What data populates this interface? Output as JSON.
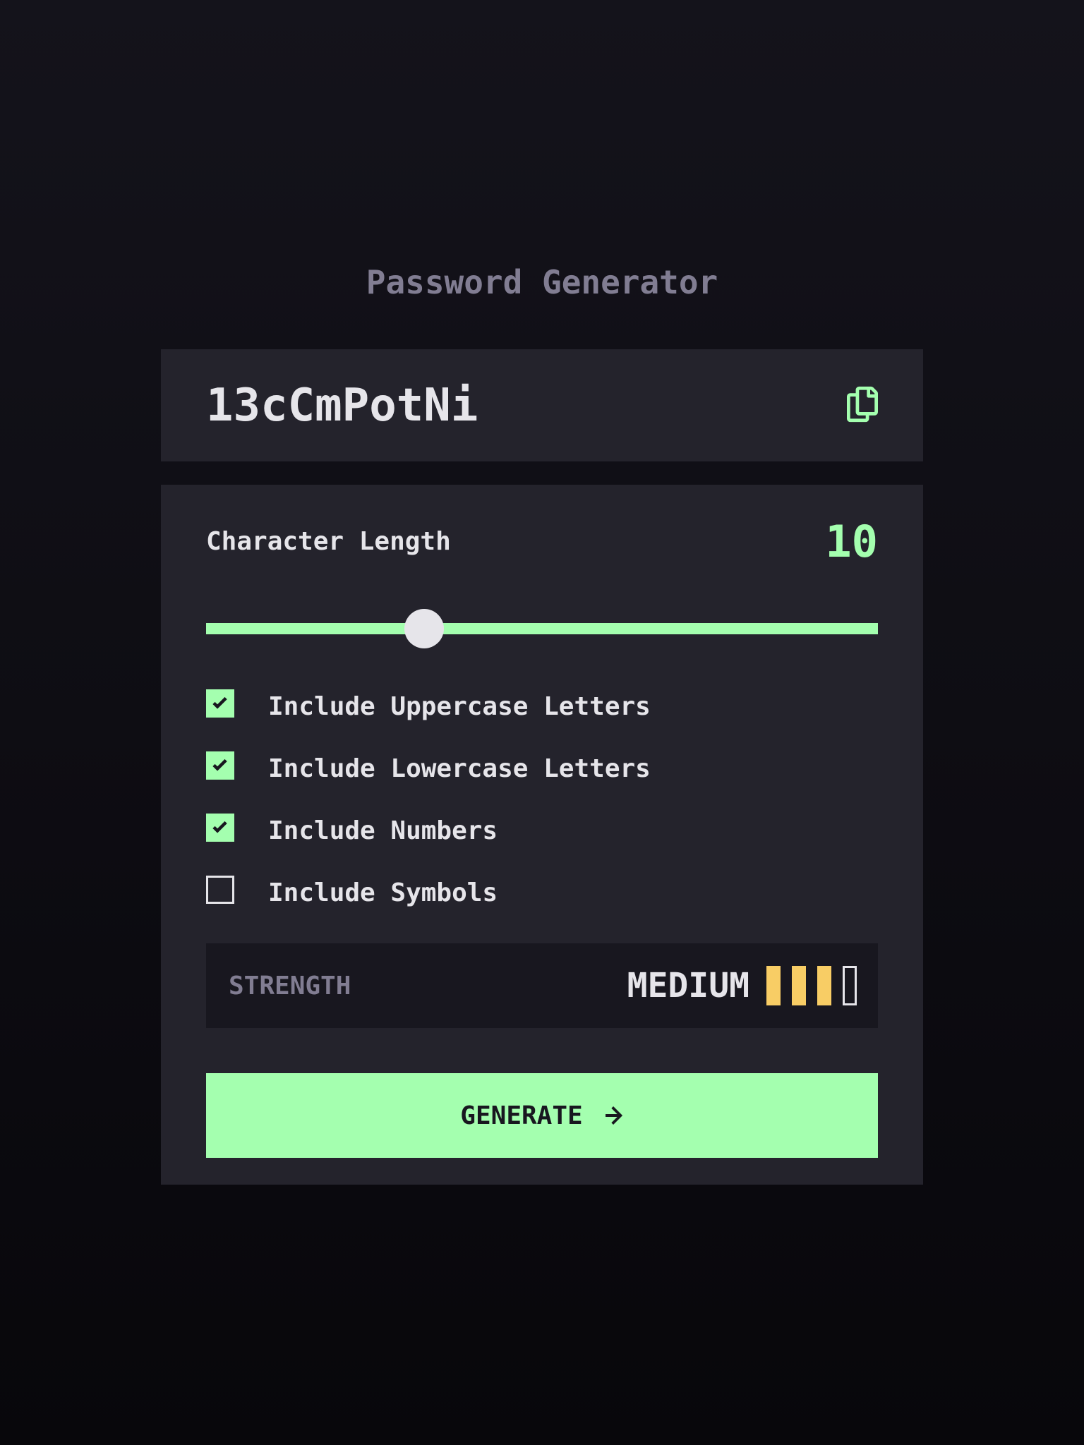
{
  "app": {
    "title": "Password Generator"
  },
  "password": {
    "value": "13cCmPotNi",
    "copy_icon": "copy-icon"
  },
  "length": {
    "label": "Character Length",
    "value": "10",
    "slider_fraction": 0.325
  },
  "options": [
    {
      "label": "Include Uppercase Letters",
      "checked": true
    },
    {
      "label": "Include Lowercase Letters",
      "checked": true
    },
    {
      "label": "Include Numbers",
      "checked": true
    },
    {
      "label": "Include Symbols",
      "checked": false
    }
  ],
  "strength": {
    "label": "STRENGTH",
    "value": "MEDIUM",
    "bars_filled": 3,
    "bars_total": 4
  },
  "generate": {
    "label": "GENERATE",
    "icon": "arrow-right-icon"
  },
  "colors": {
    "accent": "#A4FFAF",
    "strength_medium": "#F8CD65",
    "panel": "#24232C",
    "background": "#14131B",
    "muted_text": "#817D92",
    "text": "#E6E5EA"
  }
}
